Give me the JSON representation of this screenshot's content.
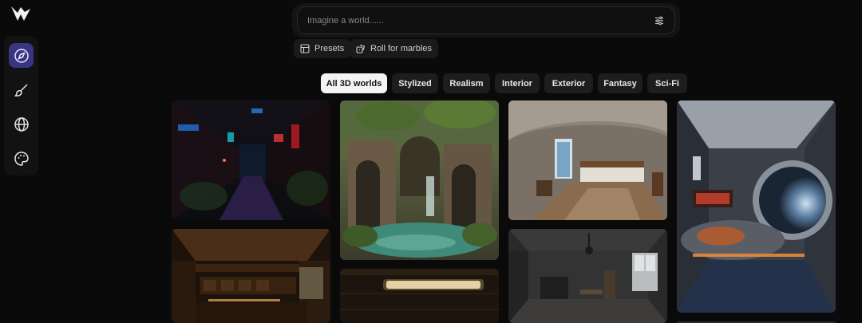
{
  "prompt": {
    "placeholder": "Imagine a world......"
  },
  "actions": {
    "presets": "Presets",
    "roll": "Roll for marbles"
  },
  "filters": {
    "items": [
      {
        "label": "All 3D worlds"
      },
      {
        "label": "Stylized"
      },
      {
        "label": "Realism"
      },
      {
        "label": "Interior"
      },
      {
        "label": "Exterior"
      },
      {
        "label": "Fantasy"
      },
      {
        "label": "Sci-Fi"
      }
    ],
    "active": "All 3D worlds"
  },
  "sidebar": {
    "items": [
      {
        "icon": "compass-icon",
        "active": true
      },
      {
        "icon": "brush-icon",
        "active": false
      },
      {
        "icon": "globe-icon",
        "active": false
      },
      {
        "icon": "palette-icon",
        "active": false
      }
    ]
  },
  "colors": {
    "accent": "#3a3580",
    "background": "#0a0a0a",
    "chip": "#1d1d1d",
    "active_chip": "#f4f4f4"
  }
}
